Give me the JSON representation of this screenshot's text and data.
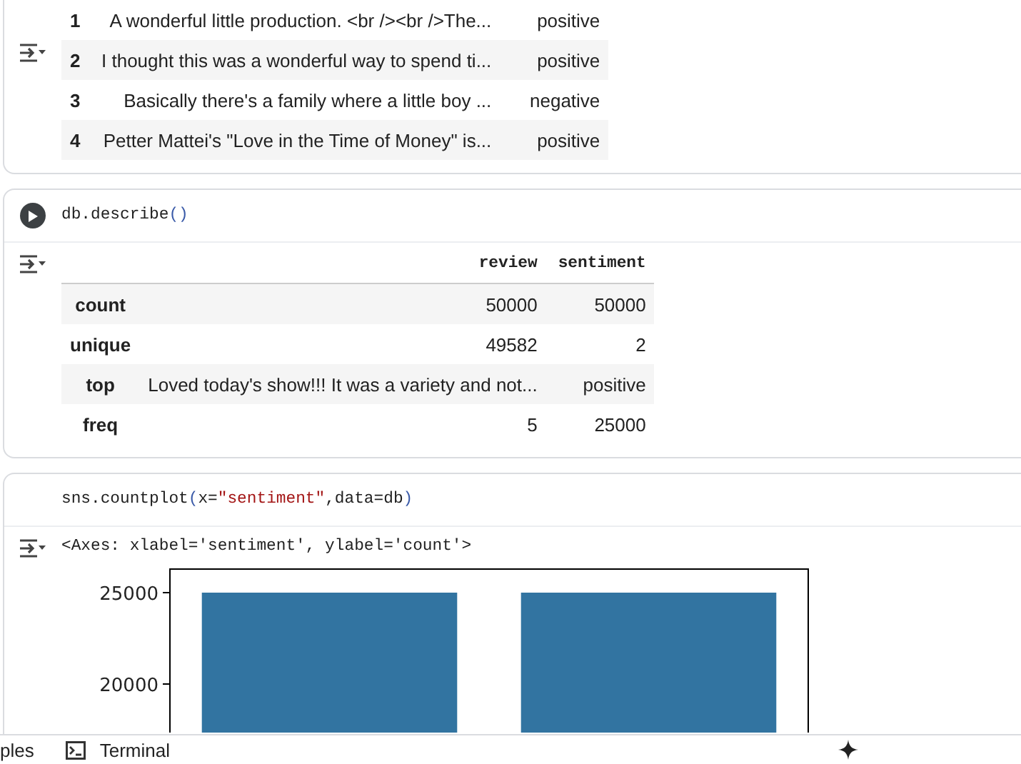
{
  "cells": [
    {
      "output": {
        "kind": "dataframe",
        "rows": [
          {
            "index": "1",
            "review": "A wonderful little production. <br /><br />The...",
            "sentiment": "positive"
          },
          {
            "index": "2",
            "review": "I thought this was a wonderful way to spend ti...",
            "sentiment": "positive"
          },
          {
            "index": "3",
            "review": "Basically there's a family where a little boy ...",
            "sentiment": "negative"
          },
          {
            "index": "4",
            "review": "Petter Mattei's \"Love in the Time of Money\" is...",
            "sentiment": "positive"
          }
        ]
      }
    },
    {
      "run_button": true,
      "code": [
        {
          "text": "db.describe",
          "kind": "plain"
        },
        {
          "text": "()",
          "kind": "paren"
        }
      ],
      "output": {
        "kind": "describe",
        "columns": [
          "review",
          "sentiment"
        ],
        "rows": [
          {
            "label": "count",
            "values": [
              "50000",
              "50000"
            ]
          },
          {
            "label": "unique",
            "values": [
              "49582",
              "2"
            ]
          },
          {
            "label": "top",
            "values": [
              "Loved today's show!!! It was a variety and not...",
              "positive"
            ]
          },
          {
            "label": "freq",
            "values": [
              "5",
              "25000"
            ]
          }
        ]
      }
    },
    {
      "code": [
        {
          "text": "sns.countplot",
          "kind": "plain"
        },
        {
          "text": "(",
          "kind": "paren"
        },
        {
          "text": "x=",
          "kind": "plain"
        },
        {
          "text": "\"sentiment\"",
          "kind": "string"
        },
        {
          "text": ",data=db",
          "kind": "plain"
        },
        {
          "text": ")",
          "kind": "paren"
        }
      ],
      "output": {
        "kind": "plot",
        "text": "<Axes: xlabel='sentiment', ylabel='count'>",
        "chart_data": {
          "type": "bar",
          "categories": [
            null,
            null
          ],
          "values": [
            25000,
            25000
          ],
          "ylim": [
            0,
            26250
          ],
          "yticks": [
            {
              "value": 20000,
              "label": "20000"
            },
            {
              "value": 25000,
              "label": "25000"
            }
          ]
        }
      }
    }
  ],
  "status_bar": {
    "items": [
      {
        "kind": "text",
        "label": "ples"
      },
      {
        "kind": "terminal",
        "label": "Terminal"
      }
    ]
  }
}
